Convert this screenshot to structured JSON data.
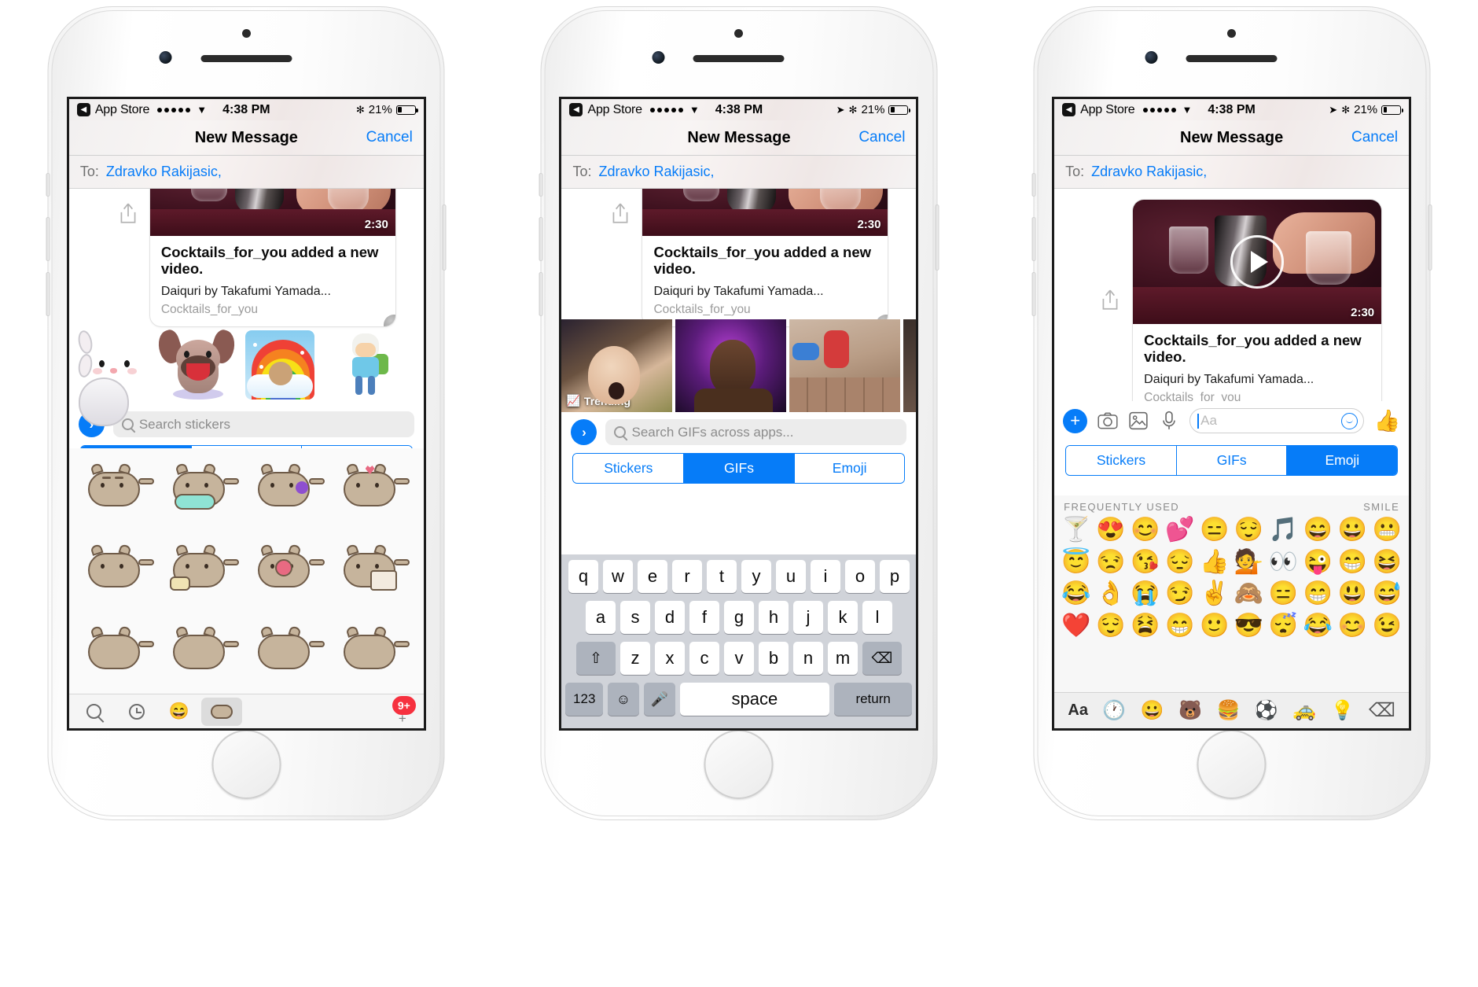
{
  "statusbar": {
    "back_label": "App Store",
    "back_icon": "chevron-left-icon",
    "carrier_dots": 5,
    "wifi_icon": "wifi-icon",
    "time": "4:38 PM",
    "location_icon": "location-arrow-icon",
    "bluetooth_icon": "bluetooth-icon",
    "battery_percent": "21%",
    "battery_icon": "battery-icon"
  },
  "navbar": {
    "title": "New Message",
    "cancel_label": "Cancel"
  },
  "recipients": {
    "label": "To:",
    "value": "Zdravko Rakijasic,"
  },
  "card": {
    "title": "Cocktails_for_you added a new video.",
    "subtitle": "Daiquri by Takafumi Yamada...",
    "source": "Cocktails_for_you",
    "duration": "2:30",
    "share_icon": "share-icon",
    "play_icon": "play-icon"
  },
  "stickers_strip": [
    {
      "name": "bunny-sticker"
    },
    {
      "name": "dog-sticker"
    },
    {
      "name": "rainbow-puppy-sticker"
    },
    {
      "name": "adventure-time-finn-sticker"
    }
  ],
  "search": {
    "stickers_placeholder": "Search stickers",
    "gifs_placeholder": "Search GIFs across apps...",
    "magnifier_icon": "search-icon",
    "expand_icon": "chevron-right-icon"
  },
  "segmented": {
    "tabs": [
      "Stickers",
      "GIFs",
      "Emoji"
    ],
    "phone1_active": "Stickers",
    "phone2_active": "GIFs",
    "phone3_active": "Emoji",
    "accent": "#067cf8"
  },
  "sticker_grid": {
    "pack_name": "pusheen",
    "rows": 3,
    "cols": 4
  },
  "app_tray": {
    "items": [
      "search-icon",
      "recents-icon",
      "emoji-app-icon",
      "pusheen-app-icon"
    ],
    "selected_index": 3,
    "badge": "9+",
    "plus_icon": "plus-icon"
  },
  "gif_strip": {
    "trending_label": "Trending",
    "trending_icon": "trending-up-icon",
    "cells": [
      "yawning-baby-gif",
      "man-purple-light-gif",
      "cheerleader-flip-gif",
      "partial-gif"
    ]
  },
  "keyboard": {
    "row1": [
      "q",
      "w",
      "e",
      "r",
      "t",
      "y",
      "u",
      "i",
      "o",
      "p"
    ],
    "row2": [
      "a",
      "s",
      "d",
      "f",
      "g",
      "h",
      "j",
      "k",
      "l"
    ],
    "row3": [
      "z",
      "x",
      "c",
      "v",
      "b",
      "n",
      "m"
    ],
    "shift_icon": "shift-icon",
    "backspace_icon": "backspace-icon",
    "numbers_label": "123",
    "emoji_icon": "emoji-icon",
    "mic_icon": "microphone-icon",
    "space_label": "space",
    "return_label": "return"
  },
  "message_toolbar": {
    "plus_icon": "plus-icon",
    "camera_icon": "camera-icon",
    "photos_icon": "photos-icon",
    "mic_icon": "microphone-icon",
    "input_placeholder": "Aa",
    "emoji_icon": "smiley-icon",
    "thumbs_up_icon": "thumbs-up-icon"
  },
  "emoji_panel": {
    "section_left": "FREQUENTLY USED",
    "section_right": "SMILE",
    "grid": [
      "🍸",
      "😍",
      "😊",
      "💕",
      "😑",
      "😌",
      "🎵",
      "😄",
      "😀",
      "😬",
      "😇",
      "😒",
      "😘",
      "😔",
      "👍",
      "💁",
      "👀",
      "😜",
      "😁",
      "😆",
      "😂",
      "👌",
      "😭",
      "😏",
      "✌️",
      "🙈",
      "😑",
      "😁",
      "😃",
      "😅",
      "❤️",
      "😌",
      "😫",
      "😁",
      "🙂",
      "😎",
      "😴",
      "😂",
      "😊",
      "😉"
    ],
    "bottom_bar": [
      "Aa",
      "🕐",
      "😀",
      "🐻",
      "🍔",
      "⚽",
      "🚕",
      "💡",
      "⌫"
    ],
    "bottom_active_index": 1
  }
}
